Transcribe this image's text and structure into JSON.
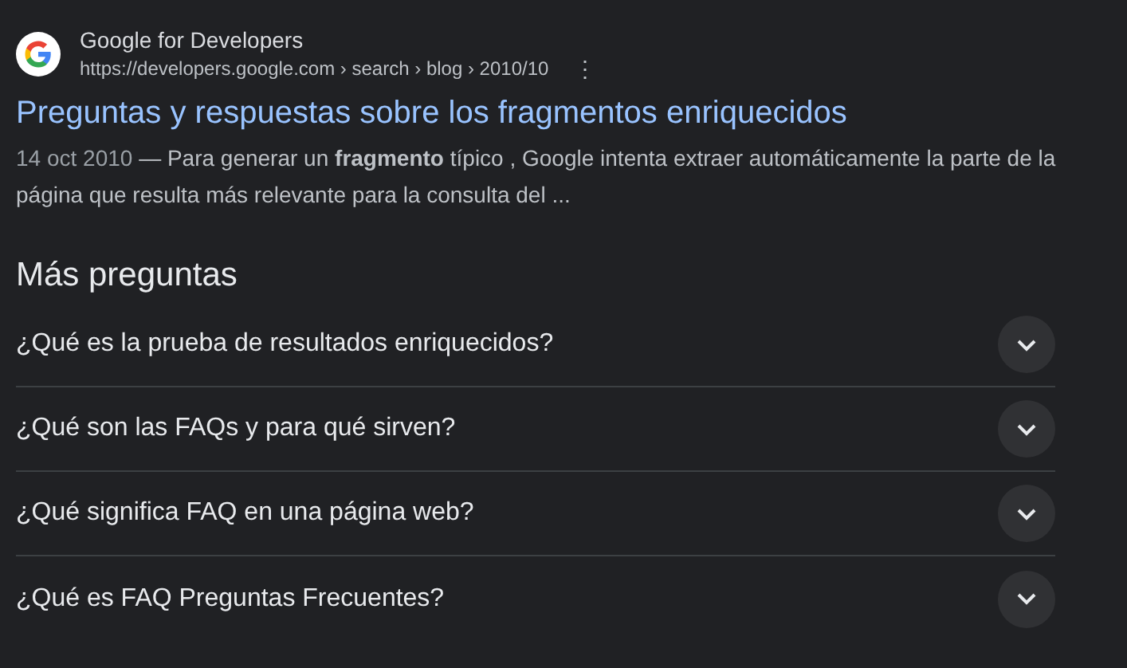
{
  "result": {
    "site_name": "Google for Developers",
    "url": "https://developers.google.com › search › blog › 2010/10",
    "menu": "⋮",
    "title": "Preguntas y respuestas sobre los fragmentos enriquecidos",
    "date": "14 oct 2010",
    "snippet": "— Para generar un **fragmento** típico , Google intenta extraer automáticamente la parte de la página que resulta más relevante para la consulta del ..."
  },
  "more_questions": {
    "heading": "Más preguntas",
    "items": [
      {
        "question": "¿Qué es la prueba de resultados enriquecidos?",
        "expanded": false
      },
      {
        "question": "¿Qué son las FAQs y para qué sirven?",
        "expanded": false
      },
      {
        "question": "¿Qué significa FAQ en una página web?",
        "expanded": false
      },
      {
        "question": "¿Qué es FAQ Preguntas Frecuentes?",
        "expanded": false
      }
    ]
  }
}
